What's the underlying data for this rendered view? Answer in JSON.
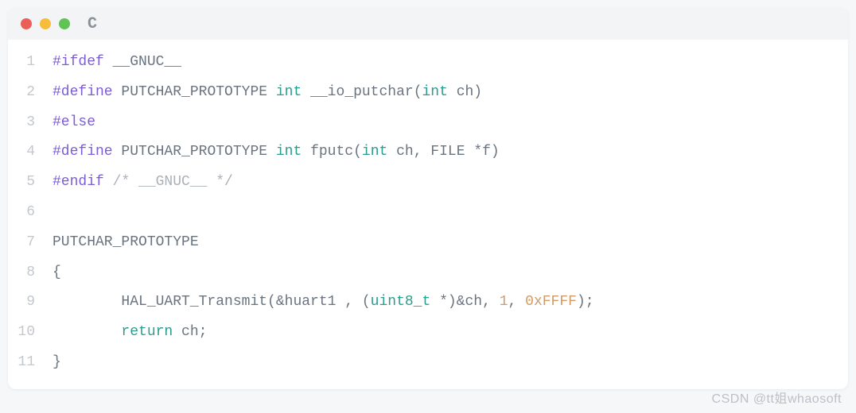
{
  "titlebar": {
    "language_label": "C"
  },
  "code": {
    "lines": [
      {
        "n": "1",
        "tokens": [
          {
            "t": "#ifdef",
            "c": "preproc"
          },
          {
            "t": " __GNUC__",
            "c": "plain"
          }
        ]
      },
      {
        "n": "2",
        "tokens": [
          {
            "t": "#define",
            "c": "preproc"
          },
          {
            "t": " PUTCHAR_PROTOTYPE ",
            "c": "plain"
          },
          {
            "t": "int",
            "c": "type"
          },
          {
            "t": " __io_putchar(",
            "c": "plain"
          },
          {
            "t": "int",
            "c": "type"
          },
          {
            "t": " ch)",
            "c": "plain"
          }
        ]
      },
      {
        "n": "3",
        "tokens": [
          {
            "t": "#else",
            "c": "preproc"
          }
        ]
      },
      {
        "n": "4",
        "tokens": [
          {
            "t": "#define",
            "c": "preproc"
          },
          {
            "t": " PUTCHAR_PROTOTYPE ",
            "c": "plain"
          },
          {
            "t": "int",
            "c": "type"
          },
          {
            "t": " fputc(",
            "c": "plain"
          },
          {
            "t": "int",
            "c": "type"
          },
          {
            "t": " ch, FILE *f)",
            "c": "plain"
          }
        ]
      },
      {
        "n": "5",
        "tokens": [
          {
            "t": "#endif",
            "c": "preproc"
          },
          {
            "t": " ",
            "c": "plain"
          },
          {
            "t": "/* __GNUC__ */",
            "c": "comment"
          }
        ]
      },
      {
        "n": "6",
        "tokens": [
          {
            "t": "",
            "c": "plain"
          }
        ]
      },
      {
        "n": "7",
        "tokens": [
          {
            "t": "PUTCHAR_PROTOTYPE",
            "c": "plain"
          }
        ]
      },
      {
        "n": "8",
        "tokens": [
          {
            "t": "{",
            "c": "punc"
          }
        ]
      },
      {
        "n": "9",
        "tokens": [
          {
            "t": "        HAL_UART_Transmit(&huart1 , (",
            "c": "plain"
          },
          {
            "t": "uint8_t",
            "c": "type"
          },
          {
            "t": " *)&ch, ",
            "c": "plain"
          },
          {
            "t": "1",
            "c": "number"
          },
          {
            "t": ", ",
            "c": "plain"
          },
          {
            "t": "0xFFFF",
            "c": "number"
          },
          {
            "t": ");",
            "c": "plain"
          }
        ]
      },
      {
        "n": "10",
        "tokens": [
          {
            "t": "        ",
            "c": "plain"
          },
          {
            "t": "return",
            "c": "return"
          },
          {
            "t": " ch;",
            "c": "plain"
          }
        ]
      },
      {
        "n": "11",
        "tokens": [
          {
            "t": "}",
            "c": "punc"
          }
        ]
      }
    ]
  },
  "watermark": {
    "text": "CSDN @tt姐whaosoft"
  },
  "colors": {
    "titlebar_bg": "#f2f4f6",
    "code_bg": "#ffffff",
    "gutter": "#c3c8ce",
    "preproc": "#7d5dd6",
    "type": "#2a9d8f",
    "number": "#d19a66",
    "comment": "#aab1b9",
    "plain": "#6a7480",
    "dot_red": "#ec5f59",
    "dot_yellow": "#f6bd3b",
    "dot_green": "#61c354"
  }
}
